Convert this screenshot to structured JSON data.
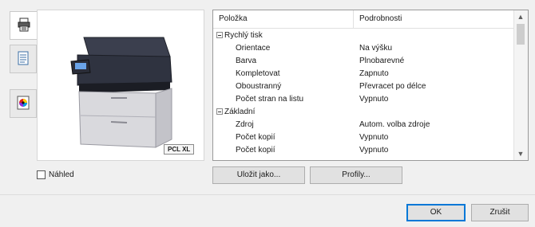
{
  "tabs": [
    {
      "icon": "printer-layout-icon",
      "active": true
    },
    {
      "icon": "document-page-icon",
      "active": false
    },
    {
      "icon": "color-palette-icon",
      "active": false
    }
  ],
  "preview": {
    "badge": "PCL XL"
  },
  "preview_checkbox": {
    "label": "Náhled",
    "checked": false
  },
  "grid": {
    "headers": {
      "item": "Položka",
      "details": "Podrobnosti"
    },
    "rows": [
      {
        "type": "group",
        "label": "Rychlý tisk",
        "value": ""
      },
      {
        "type": "item",
        "label": "Orientace",
        "value": "Na výšku"
      },
      {
        "type": "item",
        "label": "Barva",
        "value": "Plnobarevné"
      },
      {
        "type": "item",
        "label": "Kompletovat",
        "value": "Zapnuto"
      },
      {
        "type": "item",
        "label": "Oboustranný",
        "value": "Převracet po délce"
      },
      {
        "type": "item",
        "label": "Počet stran na listu",
        "value": "Vypnuto"
      },
      {
        "type": "group",
        "label": "Základní",
        "value": ""
      },
      {
        "type": "item",
        "label": "Zdroj",
        "value": "Autom. volba zdroje"
      },
      {
        "type": "item",
        "label": "Počet kopií",
        "value": "Vypnuto"
      },
      {
        "type": "item",
        "label": "Počet kopií",
        "value": "Vypnuto"
      }
    ]
  },
  "buttons": {
    "save_as": "Uložit jako...",
    "profiles": "Profily...",
    "ok": "OK",
    "cancel": "Zrušit"
  }
}
